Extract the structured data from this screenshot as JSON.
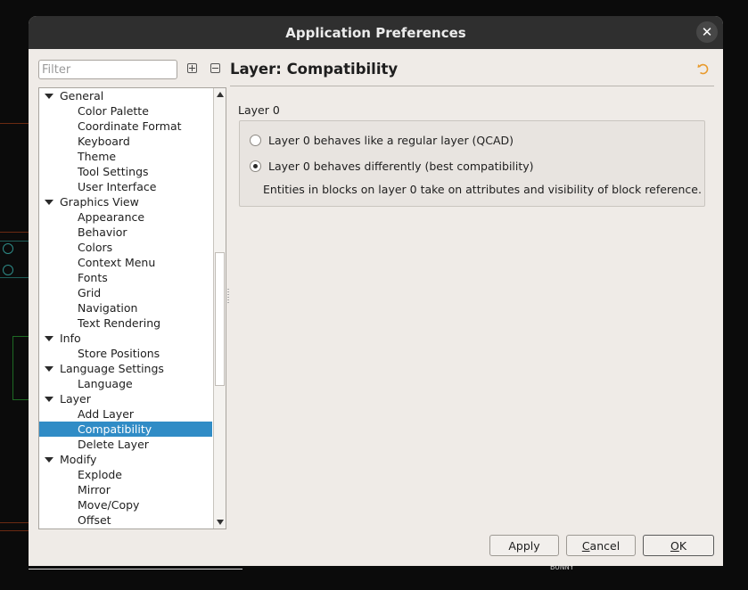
{
  "window": {
    "title": "Application Preferences",
    "close_glyph": "✕"
  },
  "filter": {
    "placeholder": "Filter"
  },
  "tree": [
    {
      "label": "General",
      "type": "parent"
    },
    {
      "label": "Color Palette",
      "type": "child"
    },
    {
      "label": "Coordinate Format",
      "type": "child"
    },
    {
      "label": "Keyboard",
      "type": "child"
    },
    {
      "label": "Theme",
      "type": "child"
    },
    {
      "label": "Tool Settings",
      "type": "child"
    },
    {
      "label": "User Interface",
      "type": "child"
    },
    {
      "label": "Graphics View",
      "type": "parent"
    },
    {
      "label": "Appearance",
      "type": "child"
    },
    {
      "label": "Behavior",
      "type": "child"
    },
    {
      "label": "Colors",
      "type": "child"
    },
    {
      "label": "Context Menu",
      "type": "child"
    },
    {
      "label": "Fonts",
      "type": "child"
    },
    {
      "label": "Grid",
      "type": "child"
    },
    {
      "label": "Navigation",
      "type": "child"
    },
    {
      "label": "Text Rendering",
      "type": "child"
    },
    {
      "label": "Info",
      "type": "parent"
    },
    {
      "label": "Store Positions",
      "type": "child"
    },
    {
      "label": "Language Settings",
      "type": "parent"
    },
    {
      "label": "Language",
      "type": "child"
    },
    {
      "label": "Layer",
      "type": "parent"
    },
    {
      "label": "Add Layer",
      "type": "child"
    },
    {
      "label": "Compatibility",
      "type": "child",
      "selected": true
    },
    {
      "label": "Delete Layer",
      "type": "child"
    },
    {
      "label": "Modify",
      "type": "parent"
    },
    {
      "label": "Explode",
      "type": "child"
    },
    {
      "label": "Mirror",
      "type": "child"
    },
    {
      "label": "Move/Copy",
      "type": "child"
    },
    {
      "label": "Offset",
      "type": "child"
    }
  ],
  "page": {
    "title": "Layer: Compatibility",
    "group_title": "Layer 0",
    "option_regular": "Layer 0 behaves like a regular layer (QCAD)",
    "option_compat": "Layer 0 behaves differently (best compatibility)",
    "selected_option": "option_compat",
    "note": "Entities in blocks on layer 0 take on attributes and visibility of block reference."
  },
  "buttons": {
    "apply": "Apply",
    "cancel_mnemonic": "C",
    "cancel_rest": "ancel",
    "ok_mnemonic": "O",
    "ok_rest": "K"
  },
  "background": {
    "canvas_text": "BONNY"
  },
  "colors": {
    "selection": "#308cc6",
    "reset_icon": "#e89a2c",
    "titlebar": "#2f2f2f"
  }
}
